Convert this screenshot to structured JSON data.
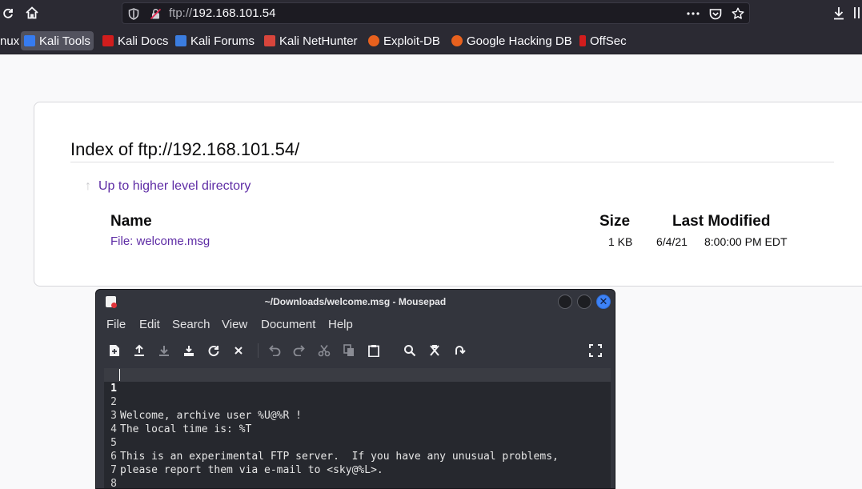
{
  "browser": {
    "url_scheme": "ftp://",
    "url_host": "192.168.101.54",
    "bookmarks": [
      {
        "label": "nux",
        "color": ""
      },
      {
        "label": "Kali Tools",
        "color": "#367bf0"
      },
      {
        "label": "Kali Docs",
        "color": "#d11d1d"
      },
      {
        "label": "Kali Forums",
        "color": "#3b7de0"
      },
      {
        "label": "Kali NetHunter",
        "color": "#d8453c"
      },
      {
        "label": "Exploit-DB",
        "color": "#e8611e"
      },
      {
        "label": "Google Hacking DB",
        "color": "#e8611e"
      },
      {
        "label": "OffSec",
        "color": "#d11d1d"
      }
    ]
  },
  "listing": {
    "title": "Index of ftp://192.168.101.54/",
    "up_link": "Up to higher level directory",
    "columns": {
      "name": "Name",
      "size": "Size",
      "modified": "Last Modified"
    },
    "files": [
      {
        "name": "File: welcome.msg",
        "size": "1 KB",
        "date": "6/4/21",
        "time": "8:00:00 PM EDT"
      }
    ]
  },
  "mousepad": {
    "title": "~/Downloads/welcome.msg - Mousepad",
    "menu": [
      "File",
      "Edit",
      "Search",
      "View",
      "Document",
      "Help"
    ],
    "lines": [
      {
        "num": "1",
        "text": "Welcome, archive user %U@%R !"
      },
      {
        "num": "2",
        "text": ""
      },
      {
        "num": "3",
        "text": "The local time is: %T"
      },
      {
        "num": "4",
        "text": ""
      },
      {
        "num": "5",
        "text": "This is an experimental FTP server.  If you have any unusual problems,"
      },
      {
        "num": "6",
        "text": "please report them via e-mail to <sky@%L>."
      },
      {
        "num": "7",
        "text": ""
      },
      {
        "num": "8",
        "text": ""
      }
    ]
  },
  "colors": {
    "link": "#5e2ca5",
    "toolbar_bg": "#2b2a33",
    "close_button": "#3d82f6"
  }
}
